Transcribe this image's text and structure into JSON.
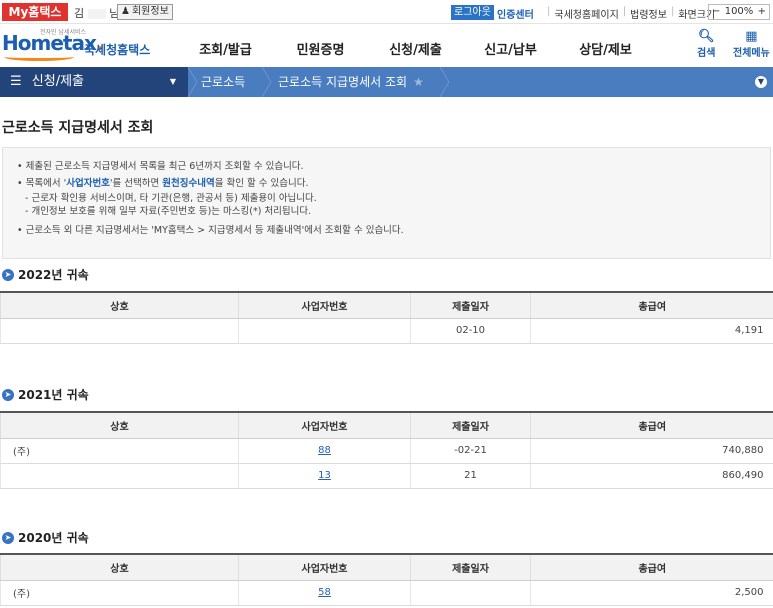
{
  "topbar": {
    "my_hometax": "My홈택스",
    "user_first": "김",
    "user_last": "님",
    "member_info": "회원정보",
    "logout": "로그아웃",
    "cert_center": "인증센터",
    "links": [
      "국세청홈페이지",
      "법령정보",
      "화면크기"
    ],
    "zoom": "100%"
  },
  "header": {
    "logo_small": "전자민 납세서비스",
    "logo_home": "Home",
    "logo_tax": "tax",
    "logo_brand": "국세청홈택스",
    "menu": [
      "조회/발급",
      "민원증명",
      "신청/제출",
      "신고/납부",
      "상담/제보"
    ],
    "search_label": "검색",
    "allmenu_label": "전체메뉴"
  },
  "breadcrumb": {
    "main": "신청/제출",
    "level2": "근로소득",
    "level3": "근로소득 지급명세서 조회"
  },
  "page_title": "근로소득 지급명세서 조회",
  "notice": {
    "line1": "제출된 근로소득 지급명세서 목록을 최근 6년까지 조회할 수 있습니다.",
    "line2_a": "목록에서 '",
    "line2_b": "사업자번호",
    "line2_c": "'를 선택하면 ",
    "line2_d": "원천징수내역",
    "line2_e": "을 확인 할 수 있습니다.",
    "sub1": "- 근로자 확인용 서비스이며, 타 기관(은행, 관공서 등) 제출용이 아닙니다.",
    "sub2": "- 개인정보 보호를 위해 일부 자료(주민번호 등)는 마스킹(*) 처리됩니다.",
    "line3": "근로소득 외 다른 지급명세서는 'MY홈택스 > 지급명세서 등 제출내역'에서 조회할 수 있습니다."
  },
  "table_headers": [
    "상호",
    "사업자번호",
    "제출일자",
    "총급여"
  ],
  "years": [
    {
      "title": "2022년 귀속",
      "rows": [
        {
          "name": "",
          "biz": "",
          "date": "02-10",
          "amount": "4,191"
        }
      ]
    },
    {
      "title": "2021년 귀속",
      "rows": [
        {
          "name": "(주)",
          "biz": "88",
          "date": "-02-21",
          "amount": "740,880"
        },
        {
          "name": "",
          "biz": "13",
          "date": "21",
          "amount": "860,490"
        }
      ]
    },
    {
      "title": "2020년 귀속",
      "rows": [
        {
          "name": "(주)",
          "biz": "58",
          "date": "",
          "amount": "2,500"
        }
      ]
    }
  ]
}
